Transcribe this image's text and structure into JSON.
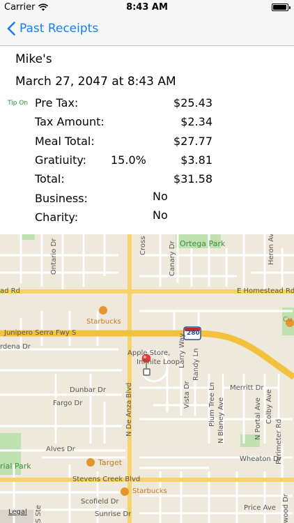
{
  "status": {
    "carrier": "Carrier",
    "time": "8:43 AM",
    "battery_level": 0.95
  },
  "nav": {
    "back_label": "Past Receipts"
  },
  "receipt": {
    "place": "Mike's",
    "datetime": "March 27, 2047 at 8:43 AM",
    "tip_on": "Tip On",
    "rows": [
      {
        "label": "Pre Tax:",
        "value": "$25.43"
      },
      {
        "label": "Tax Amount:",
        "value": "$2.34"
      },
      {
        "label": "Meal Total:",
        "value": "$27.77"
      },
      {
        "label": "Gratiuity:",
        "percent": "15.0%",
        "value": "$3.81"
      },
      {
        "label": "Total:",
        "value": "$31.58"
      },
      {
        "label": "Business:",
        "value": "No"
      },
      {
        "label": "Charity:",
        "value": "No"
      }
    ]
  },
  "map": {
    "labels": {
      "ortega_park": "Ortega Park",
      "heron_ave": "Heron Ave",
      "canary_dr": "Canary Dr",
      "cross_dr": "Cross Dr",
      "ontario_dr": "Ontario Dr",
      "homestead_rd_right": "E Homestead Rd",
      "homestead_rd_left": "ad Rd",
      "starbucks_1": "Starbucks",
      "cupertino": "Cu",
      "junipero_serra": "Junipero Serra Fwy S",
      "highway": "280",
      "apple_store": "Apple Store,",
      "infinite_loop": "Infinite Loop",
      "rdena_dr": "rdena Dr",
      "larry_way": "Larry Way",
      "randy_ln": "Randy Ln",
      "merritt_dr": "Merritt Dr",
      "dunbar_dr": "Dunbar Dr",
      "fargo_dr": "Fargo Dr",
      "n_de_anza_blvd": "N De Anza Blvd",
      "vista_dr": "Vista Dr",
      "plum_tree_ln": "Plum Tree Ln",
      "n_blaney_ave": "N Blaney Ave",
      "n_portal_ave": "N Portal Ave",
      "colby_ave": "Colby Ave",
      "alves_dr": "Alves Dr",
      "target": "Target",
      "wheaton_dr": "Wheaton Dr",
      "rial_park": "rial Park",
      "perimeter_rd": "Perimeter Rd",
      "stevens_creek": "Stevens Creek Blvd",
      "starbucks_2": "Starbucks",
      "scofield_dr": "Scofield Dr",
      "price_ave": "Price Ave",
      "sunrise_dr": "Sunrise Dr",
      "s_ste": "S Ste",
      "wood_dr": "wood Dr"
    },
    "legal": "Legal"
  }
}
